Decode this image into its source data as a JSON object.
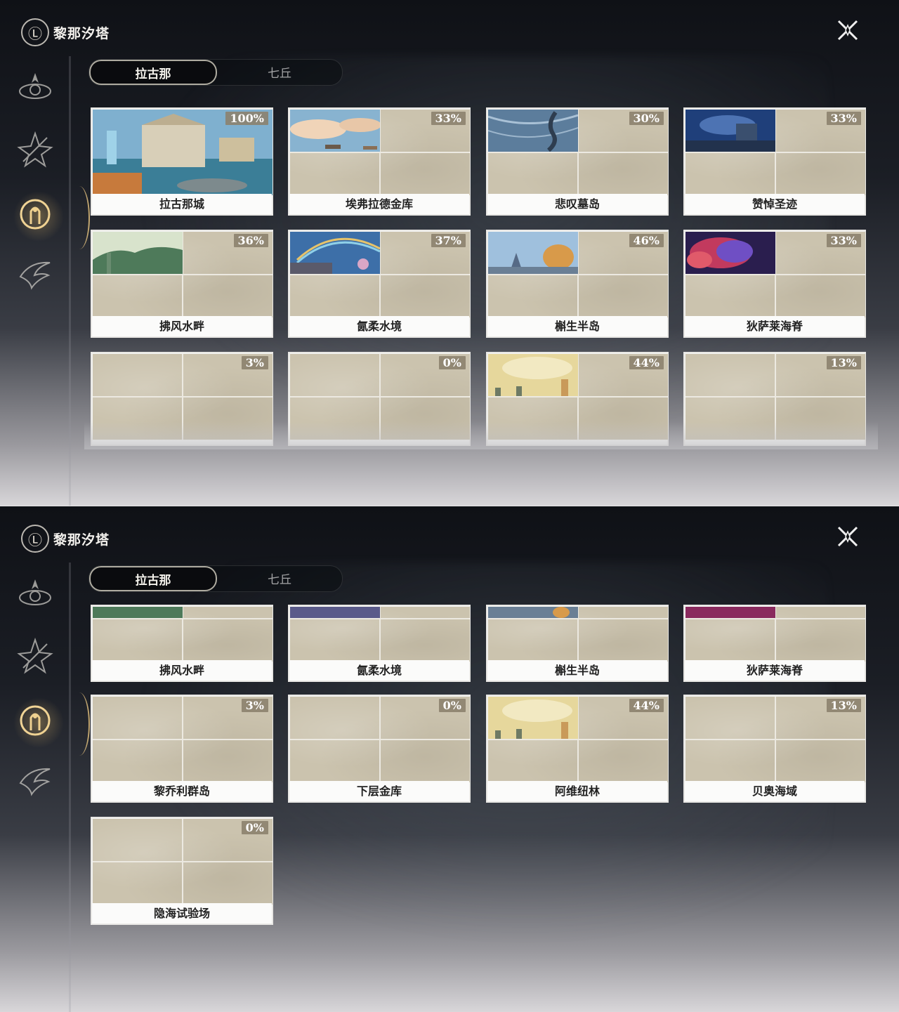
{
  "panels": [
    {
      "title": "黎那汐塔",
      "emblem_glyph": "Ⓛ",
      "tabs": [
        {
          "label": "拉古那",
          "active": true
        },
        {
          "label": "七丘",
          "active": false
        }
      ]
    },
    {
      "title": "黎那汐塔",
      "emblem_glyph": "Ⓛ",
      "tabs": [
        {
          "label": "拉古那",
          "active": true
        },
        {
          "label": "七丘",
          "active": false
        }
      ]
    }
  ],
  "regions": [
    {
      "name": "拉古那城",
      "progress": "100%",
      "scene": "city"
    },
    {
      "name": "埃弗拉德金库",
      "progress": "33%",
      "scene": "sky"
    },
    {
      "name": "悲叹墓岛",
      "progress": "30%",
      "scene": "storm"
    },
    {
      "name": "赞悼圣迹",
      "progress": "33%",
      "scene": "night"
    },
    {
      "name": "拂风水畔",
      "progress": "36%",
      "scene": "green"
    },
    {
      "name": "氤柔水境",
      "progress": "37%",
      "scene": "rainbow"
    },
    {
      "name": "槲生半岛",
      "progress": "46%",
      "scene": "autumn"
    },
    {
      "name": "狄萨莱海脊",
      "progress": "33%",
      "scene": "nebula"
    },
    {
      "name": "黎乔利群岛",
      "progress": "3%",
      "scene": "none"
    },
    {
      "name": "下层金库",
      "progress": "0%",
      "scene": "none"
    },
    {
      "name": "阿维纽林",
      "progress": "44%",
      "scene": "desert"
    },
    {
      "name": "贝奥海域",
      "progress": "13%",
      "scene": "none"
    },
    {
      "name": "隐海试验场",
      "progress": "0%",
      "scene": "none"
    }
  ],
  "colors": {
    "accent_gold": "#e6be6e",
    "card_paper": "#cbc3ae",
    "badge": "#8c826e"
  },
  "icons": {
    "close": "close-x-icon",
    "nav": [
      "emblem-nav-icon",
      "star-nav-icon",
      "linascita-nav-icon",
      "wing-nav-icon"
    ]
  }
}
